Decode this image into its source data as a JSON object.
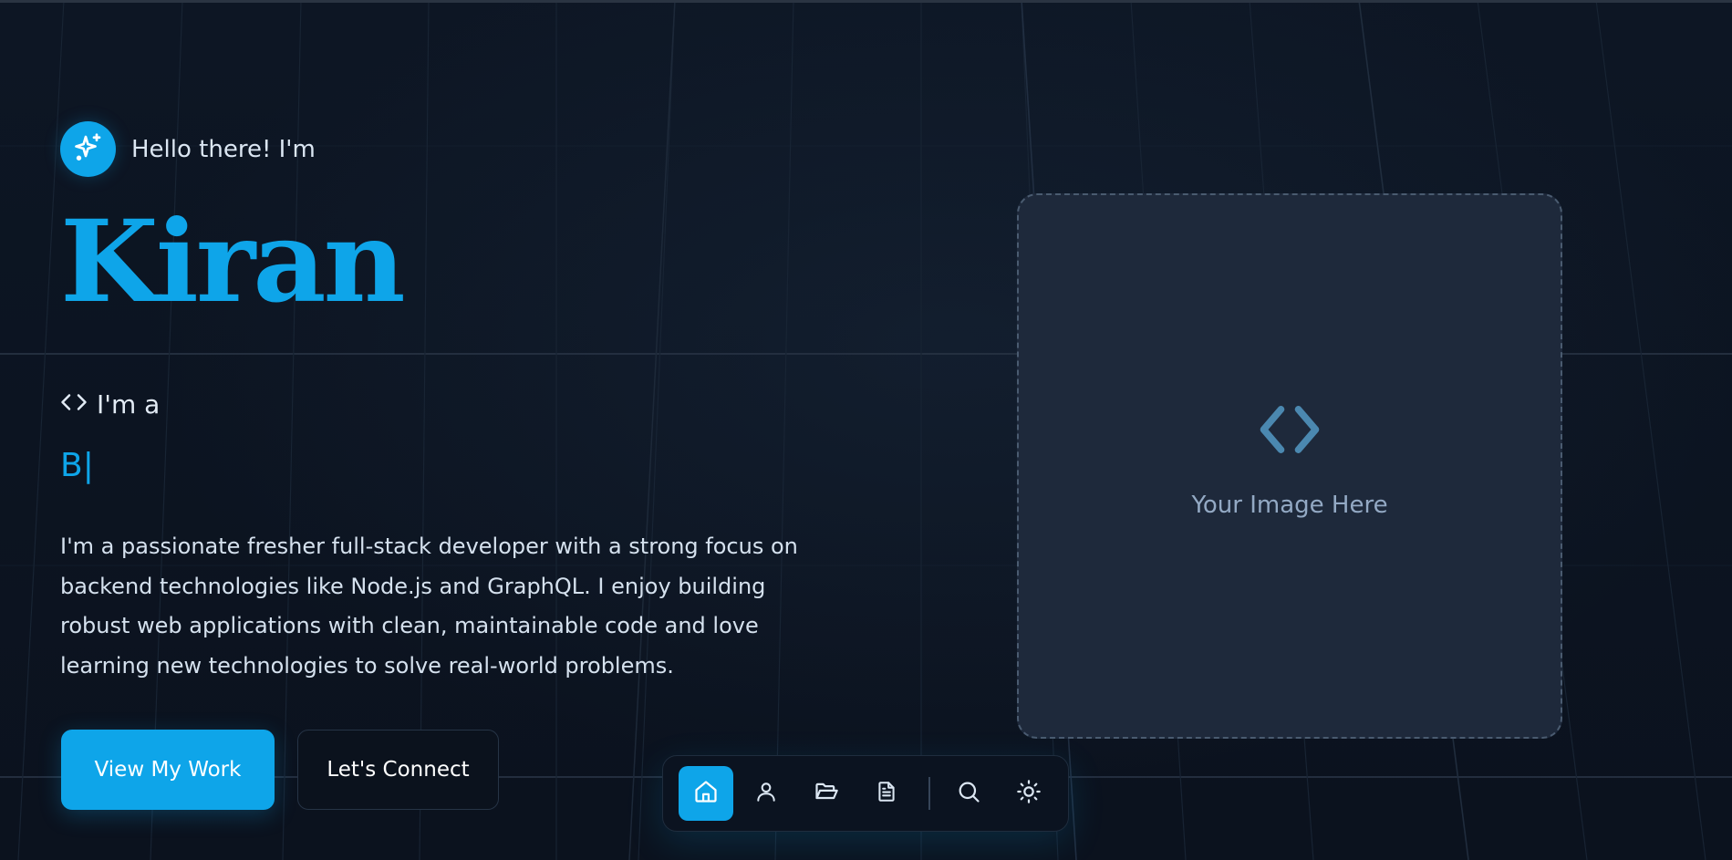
{
  "greeting": {
    "text": "Hello there! I'm",
    "icon": "sparkles-icon"
  },
  "hero": {
    "name": "Kiran",
    "role_prefix": "I'm a",
    "role_icon": "code-brackets-icon",
    "typed_text": "B",
    "typed_caret": "|",
    "bio": "I'm a passionate fresher full-stack developer with a strong focus on backend technologies like Node.js and GraphQL. I enjoy building robust web applications with clean, maintainable code and love learning new technologies to solve real-world problems."
  },
  "buttons": {
    "primary_label": "View My Work",
    "secondary_label": "Let's Connect"
  },
  "image_placeholder": {
    "label": "Your Image Here",
    "icon": "code-brackets-icon"
  },
  "dock": {
    "items": [
      {
        "icon": "home-icon",
        "active": true
      },
      {
        "icon": "user-icon",
        "active": false
      },
      {
        "icon": "folder-icon",
        "active": false
      },
      {
        "icon": "document-icon",
        "active": false
      },
      {
        "icon": "search-icon",
        "active": false
      },
      {
        "icon": "sun-icon",
        "active": false
      }
    ]
  },
  "colors": {
    "accent": "#0ea5e9",
    "background": "#0c1320",
    "card": "#1e293b",
    "text": "#dbe6f2"
  }
}
